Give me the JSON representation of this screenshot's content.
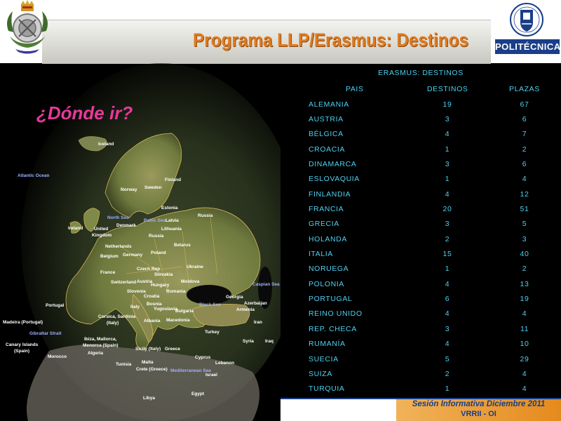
{
  "header": {
    "title": "Programa LLP/Erasmus: Destinos",
    "logo_label": "POLITÉCNICA"
  },
  "map": {
    "question": "¿Dónde ir?",
    "labels": {
      "iceland": "Iceland",
      "atlantic": "Atlantic Ocean",
      "finland": "Finland",
      "norway": "Norway",
      "sweden": "Sweden",
      "estonia": "Estonia",
      "north_sea": "North Sea",
      "baltic_sea": "Baltic Sea",
      "latvia": "Latvia",
      "lithuania": "Lithuania",
      "russia_e": "Russia",
      "russia_k": "Russia",
      "ireland": "Ireland",
      "uk1": "United",
      "uk2": "Kingdom",
      "denmark": "Denmark",
      "belarus": "Belarus",
      "netherlands": "Netherlands",
      "belgium": "Belgium",
      "germany": "Germany",
      "poland": "Poland",
      "ukraine": "Ukraine",
      "france": "France",
      "czech": "Czech Rep",
      "slovakia": "Slovakia",
      "moldova": "Moldova",
      "switzerland": "Switzerland",
      "austria": "Austria",
      "hungary": "Hungary",
      "slovenia": "Slovenia",
      "romania": "Romania",
      "croatia": "Croatia",
      "bosnia": "Bosnia",
      "serbia": "Yugoslavia",
      "bulgaria": "Bulgaria",
      "caspian": "Caspian Sea",
      "georgia": "Georgia",
      "azerbaijan": "Azerbaijan",
      "armenia": "Armenia",
      "black_sea": "Black Sea",
      "portugal": "Portugal",
      "italy": "Italy",
      "corsica1": "Corsica, Sardinia",
      "corsica2": "(Italy)",
      "albania": "Albania",
      "macedonia": "Macedonia",
      "turkey": "Turkey",
      "madeira": "Madeira (Portugal)",
      "gibraltar": "Gibraltar Strait",
      "iran": "Iran",
      "ibiza1": "Ibiza, Mallorca,",
      "ibiza2": "Menorca (Spain)",
      "sicily": "Sicily (Italy)",
      "greece": "Greece",
      "canary1": "Canary Islands",
      "canary2": "(Spain)",
      "algeria": "Algeria",
      "morocco": "Morocco",
      "tunisia": "Tunisia",
      "syria": "Syria",
      "iraq": "Iraq",
      "cyprus": "Cyprus",
      "lebanon": "Lebanon",
      "israel": "Israel",
      "malta": "Malta",
      "crete": "Crete (Greece)",
      "med": "Mediterranean Sea",
      "libya": "Libya",
      "egypt": "Egypt"
    }
  },
  "table": {
    "title": "ERASMUS: DESTINOS",
    "headers": [
      "PAIS",
      "DESTINOS",
      "PLAZAS"
    ],
    "rows": [
      {
        "pais": "ALEMANIA",
        "destinos": "19",
        "plazas": "67"
      },
      {
        "pais": "AUSTRIA",
        "destinos": "3",
        "plazas": "6"
      },
      {
        "pais": "BÉLGICA",
        "destinos": "4",
        "plazas": "7"
      },
      {
        "pais": "CROACIA",
        "destinos": "1",
        "plazas": "2"
      },
      {
        "pais": "DINAMARCA",
        "destinos": "3",
        "plazas": "6"
      },
      {
        "pais": "ESLOVAQUIA",
        "destinos": "1",
        "plazas": "4"
      },
      {
        "pais": "FINLANDIA",
        "destinos": "4",
        "plazas": "12"
      },
      {
        "pais": "FRANCIA",
        "destinos": "20",
        "plazas": "51"
      },
      {
        "pais": "GRECIA",
        "destinos": "3",
        "plazas": "5"
      },
      {
        "pais": "HOLANDA",
        "destinos": "2",
        "plazas": "3"
      },
      {
        "pais": "ITALIA",
        "destinos": "15",
        "plazas": "40"
      },
      {
        "pais": "NORUEGA",
        "destinos": "1",
        "plazas": "2"
      },
      {
        "pais": "POLONIA",
        "destinos": "4",
        "plazas": "13"
      },
      {
        "pais": "PORTUGAL",
        "destinos": "6",
        "plazas": "19"
      },
      {
        "pais": "REINO UNIDO",
        "destinos": "4",
        "plazas": "4"
      },
      {
        "pais": "REP. CHECA",
        "destinos": "3",
        "plazas": "11"
      },
      {
        "pais": "RUMANÍA",
        "destinos": "4",
        "plazas": "10"
      },
      {
        "pais": "SUECIA",
        "destinos": "5",
        "plazas": "29"
      },
      {
        "pais": "SUIZA",
        "destinos": "2",
        "plazas": "4"
      },
      {
        "pais": "TURQUIA",
        "destinos": "1",
        "plazas": "4"
      }
    ]
  },
  "footer": {
    "line1": "Sesión Informativa Diciembre 2011",
    "line2": "VRRII - OI"
  },
  "colors": {
    "title_orange": "#e07a1e",
    "table_text": "#4fd0f0",
    "question_pink": "#e8389a",
    "brand_blue": "#1a3e88"
  }
}
